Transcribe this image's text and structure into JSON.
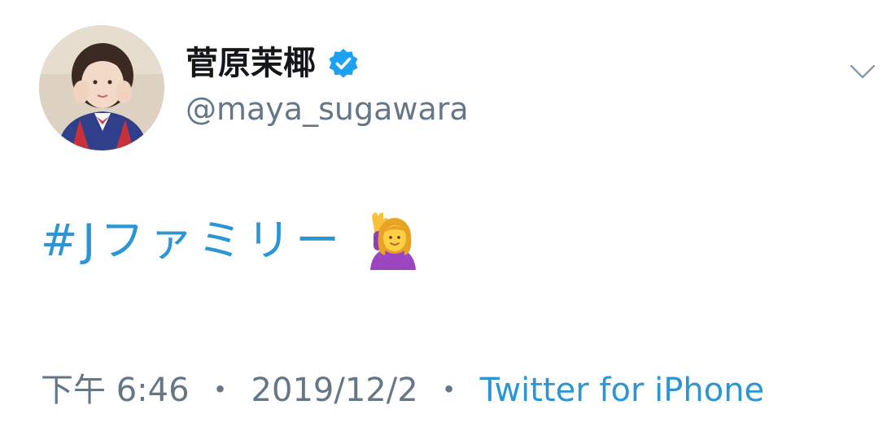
{
  "user": {
    "display_name": "菅原茉椰",
    "handle": "@maya_sugawara",
    "verified": true,
    "avatar_icon": "profile-photo"
  },
  "tweet": {
    "hashtag": "#Jファミリー",
    "emoji": "person-raising-hand",
    "time": "下午 6:46",
    "separator": "・",
    "date": "2019/12/2",
    "source": "Twitter for iPhone"
  },
  "menu": {
    "icon": "chevron-down-icon"
  },
  "colors": {
    "link": "#2b95d6",
    "secondary_text": "#657786",
    "primary_text": "#14171a",
    "verified_badge": "#1da1f2"
  }
}
